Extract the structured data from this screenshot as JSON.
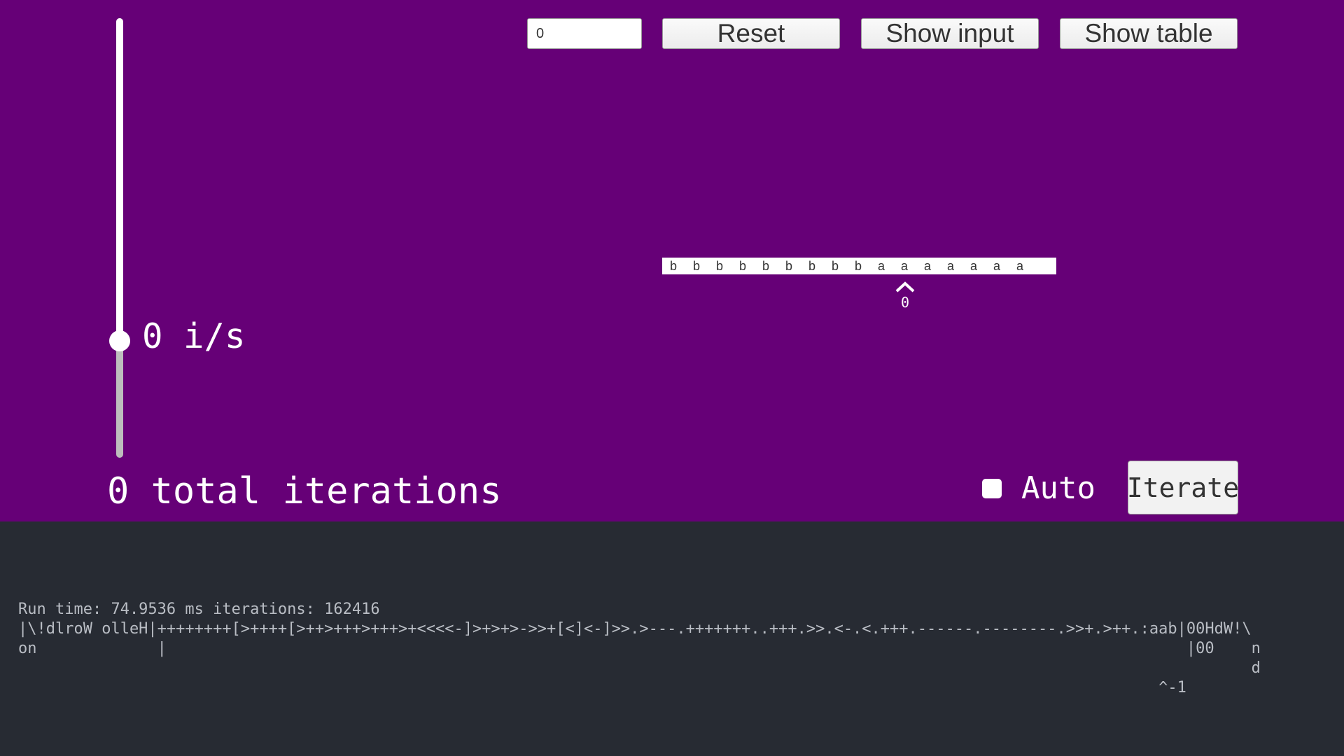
{
  "speed": {
    "value_text": "0 i/s",
    "slider_level": 0.266
  },
  "iterations": {
    "total_text": "0 total iterations"
  },
  "controls": {
    "input_value": "0",
    "reset_label": "Reset",
    "show_input_label": "Show input",
    "show_table_label": "Show table",
    "auto_label": "Auto",
    "auto_checked": false,
    "iterate_label": "Iterate"
  },
  "tape": {
    "cells": [
      "b",
      "b",
      "b",
      "b",
      "b",
      "b",
      "b",
      "b",
      "b",
      "a",
      "a",
      "a",
      "a",
      "a",
      "a",
      "a"
    ],
    "head_index": 9,
    "head_state": "0"
  },
  "console": {
    "lines": [
      "Run time: 74.9536 ms iterations: 162416",
      "|\\!dlroW olleH|++++++++[>++++[>++>+++>+++>+<<<<-]>+>+>->>+[<]<-]>>.>---.+++++++..+++.>>.<-.<.+++.------.--------.>>+.>++.:aab|00HdW!\\",
      "on             |                                                                                                              |00    n",
      "                                                                                                                                     d",
      "                                                                                                                           ^-1"
    ]
  },
  "colors": {
    "top_background": "#660077",
    "bottom_background": "#272b33",
    "console_text": "#b9bdc4"
  }
}
